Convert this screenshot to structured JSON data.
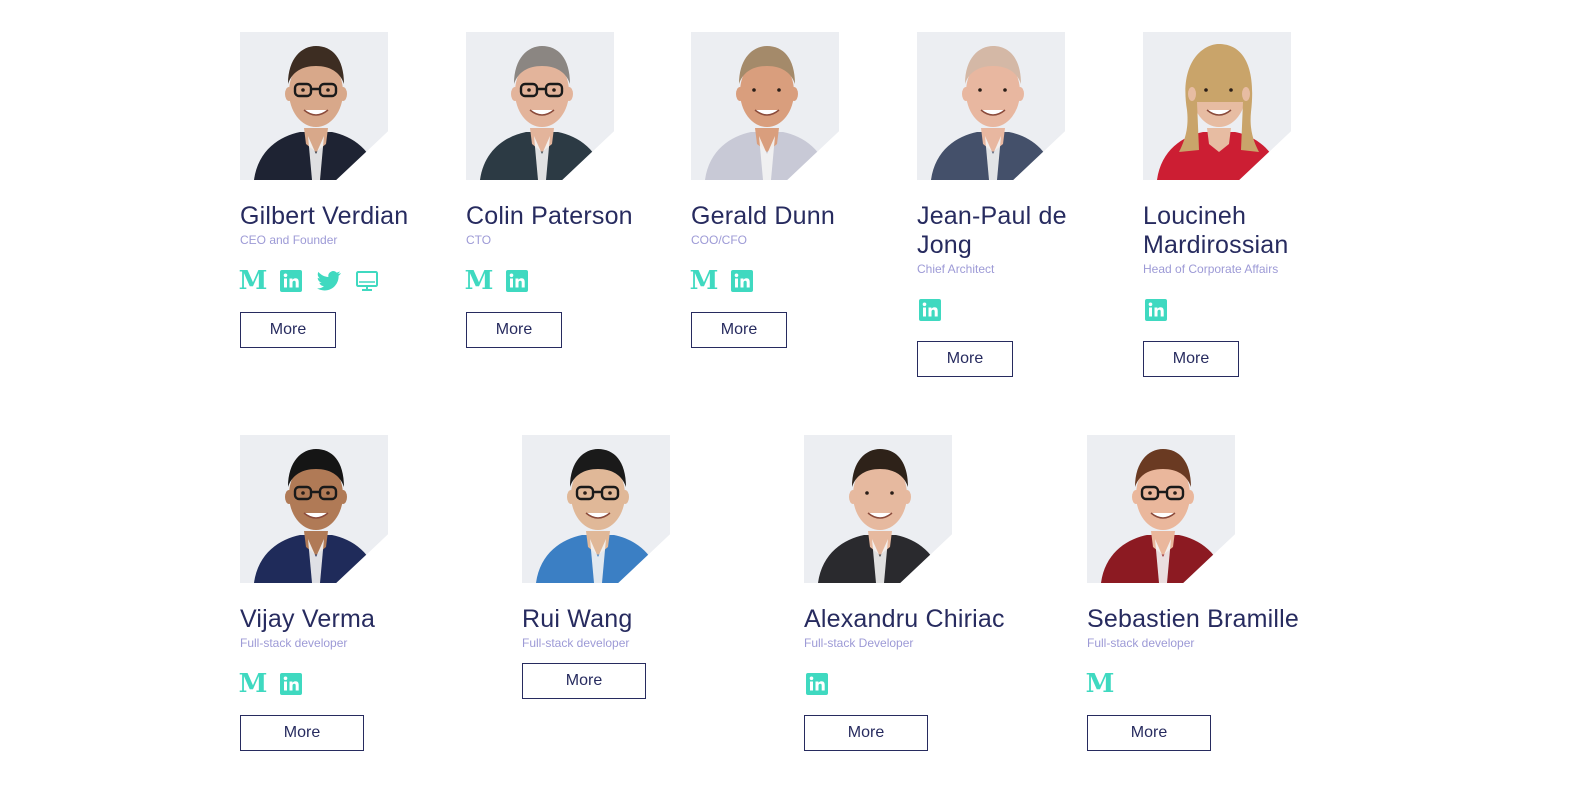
{
  "team": [
    {
      "name": "Gilbert Verdian",
      "role": "CEO and Founder",
      "icons": [
        "medium-icon",
        "linkedin-icon",
        "twitter-icon",
        "website-icon"
      ],
      "more": "More",
      "skin": "#d8a88a",
      "shirt": "#1e2333",
      "hair": "#3d2d22"
    },
    {
      "name": "Colin Paterson",
      "role": "CTO",
      "icons": [
        "medium-icon",
        "linkedin-icon"
      ],
      "more": "More",
      "skin": "#e3b49b",
      "shirt": "#2c3a44",
      "hair": "#8b8682"
    },
    {
      "name": "Gerald Dunn",
      "role": "COO/CFO",
      "icons": [
        "medium-icon",
        "linkedin-icon"
      ],
      "more": "More",
      "skin": "#d99e7d",
      "shirt": "#c8c9d6",
      "hair": "#a48a6a"
    },
    {
      "name": "Jean-Paul de Jong",
      "role": "Chief Architect",
      "icons": [
        "linkedin-icon"
      ],
      "more": "More",
      "skin": "#e8b7a0",
      "shirt": "#44506a",
      "hair": "#d4b8a6"
    },
    {
      "name": "Loucineh Mardirossian",
      "role": "Head of Corporate Affairs",
      "icons": [
        "linkedin-icon"
      ],
      "more": "More",
      "skin": "#e7bca2",
      "shirt": "#cc1e33",
      "hair": "#c9a46a"
    },
    {
      "name": "Vijay Verma",
      "role": "Full-stack developer",
      "icons": [
        "medium-icon",
        "linkedin-icon"
      ],
      "more": "More",
      "skin": "#b07a56",
      "shirt": "#1f2b5a",
      "hair": "#151515"
    },
    {
      "name": "Rui Wang",
      "role": "Full-stack developer",
      "icons": [],
      "more": "More",
      "skin": "#e0b898",
      "shirt": "#3b7fc4",
      "hair": "#1a1a1a"
    },
    {
      "name": "Alexandru Chiriac",
      "role": "Full-stack Developer",
      "icons": [
        "linkedin-icon"
      ],
      "more": "More",
      "skin": "#e6b99f",
      "shirt": "#2a2a2e",
      "hair": "#2e2219"
    },
    {
      "name": "Sebastien Bramille",
      "role": "Full-stack developer",
      "icons": [
        "medium-icon"
      ],
      "more": "More",
      "skin": "#eab79c",
      "shirt": "#8c1a22",
      "hair": "#6a3a22"
    }
  ],
  "colors": {
    "navy": "#272b5f",
    "accent": "#3fd9c0",
    "role": "#9d9ad6"
  }
}
